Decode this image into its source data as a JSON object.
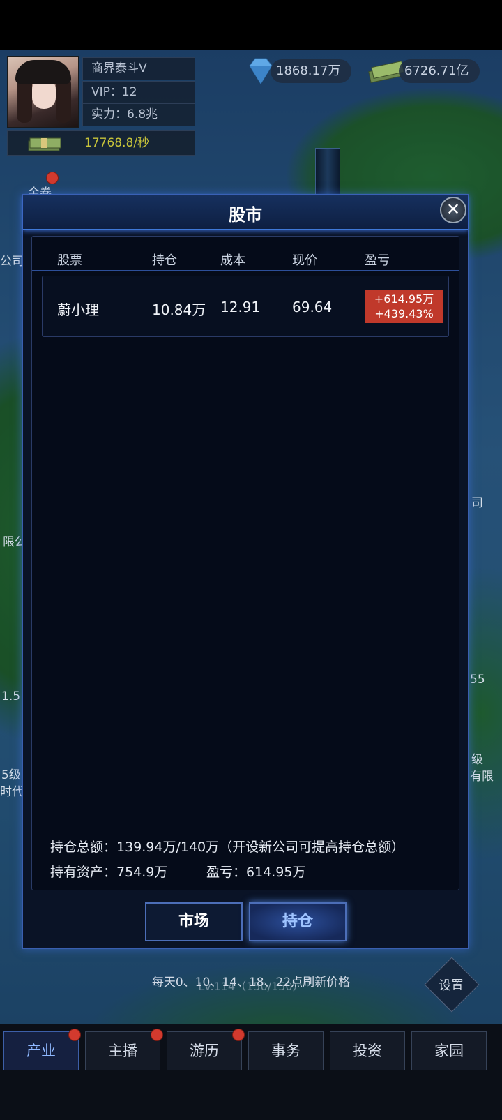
{
  "profile": {
    "name": "商界泰斗V",
    "vip": "VIP：12",
    "power": "实力：6.8兆",
    "income": "17768.8/秒"
  },
  "resources": {
    "diamonds": "1868.17万",
    "cash": "6726.71亿"
  },
  "side_labels": {
    "left_1": "公司",
    "left_2": "限公",
    "left_3": "1.5",
    "left_4": "5级",
    "left_5": "时代",
    "right_1": "司",
    "right_2": "55",
    "right_3": "级",
    "right_4": "有限",
    "top_left": "金卷"
  },
  "modal": {
    "title": "股市",
    "close_label": "✕",
    "columns": [
      "股票",
      "持仓",
      "成本",
      "现价",
      "盈亏"
    ],
    "rows": [
      {
        "stock": "蔚小理",
        "position": "10.84万",
        "cost": "12.91",
        "price": "69.64",
        "pl_amount": "+614.95万",
        "pl_percent": "+439.43%"
      }
    ],
    "summary": {
      "total": "持仓总额：139.94万/140万（开设新公司可提高持仓总额）",
      "assets": "持有资产：754.9万",
      "profit": "盈亏：614.95万"
    },
    "tabs": {
      "market": "市场",
      "holdings": "持仓"
    }
  },
  "refresh_note": "每天0、10、14、18、22点刷新价格",
  "level_note": "Lv.114（150/150）",
  "settings_label": "设置",
  "nav": [
    "产业",
    "主播",
    "游历",
    "事务",
    "投资",
    "家园"
  ],
  "colors": {
    "accent": "#3f78d8",
    "profit_badge": "#c0392b",
    "income_text": "#c8c43a"
  }
}
